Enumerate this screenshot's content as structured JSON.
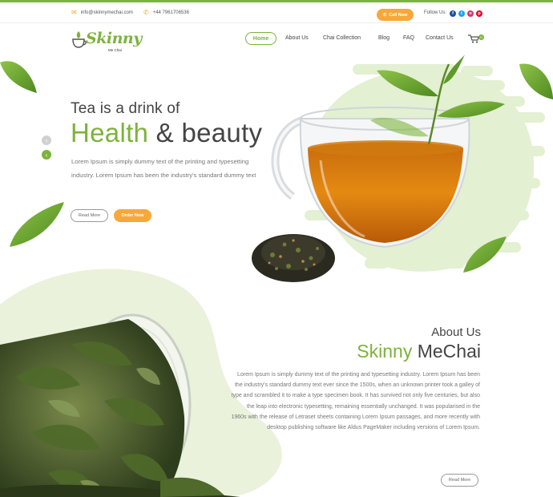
{
  "topbar": {
    "email": "info@skinnymechai.com",
    "phone": "+44 7961706536",
    "call_label": "Call Now",
    "follow_label": "Follow Us:",
    "socials": [
      {
        "name": "facebook",
        "glyph": "f",
        "color": "#1e4ea0"
      },
      {
        "name": "twitter",
        "glyph": "t",
        "color": "#1da1f2"
      },
      {
        "name": "instagram",
        "glyph": "o",
        "color": "#d6336c"
      },
      {
        "name": "pinterest",
        "glyph": "p",
        "color": "#e60023"
      }
    ]
  },
  "logo": {
    "name": "Skinny",
    "sub": "Me Chai"
  },
  "nav": {
    "items": [
      "Home",
      "About Us",
      "Chai Collection",
      "Blog",
      "FAQ",
      "Contact Us"
    ],
    "active": "Home",
    "cart_count": "0"
  },
  "hero": {
    "small": "Tea is a drink of",
    "big_green": "Health",
    "big_dark": "& beauty",
    "text": "Lorem Ipsum is simply dummy text of the printing and typesetting industry. Lorem Ipsum has been the industry's standard dummy text",
    "read_more": "Read More",
    "order_now": "Order Now"
  },
  "about": {
    "label": "About Us",
    "title_green": "Skinny",
    "title_dark": "MeChai",
    "text": "Lorem Ipsum is simply dummy text of the printing and typesetting industry. Lorem Ipsum has been the industry's standard dummy text ever since the 1500s, when an unknown printer took a galley of type and scrambled it to make a type specimen book. It has survived not only five centuries, but also the leap into electronic typesetting, remaining essentially unchanged. It was popularised in the 1960s with the release of Letraset sheets containing Lorem Ipsum passages, and more recently with desktop publishing software like Aldus PageMaker including versions of Lorem Ipsum.",
    "read_more": "Read More"
  },
  "colors": {
    "accent_green": "#7cb33a",
    "accent_orange": "#f6a83a",
    "text_dark": "#444444"
  }
}
